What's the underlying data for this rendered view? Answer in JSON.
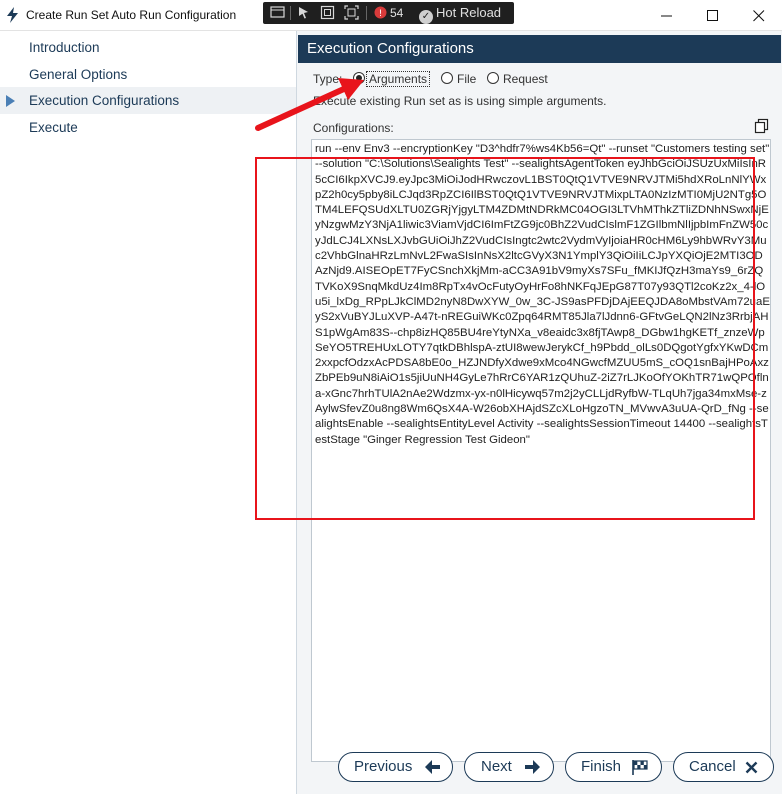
{
  "window": {
    "title": "Create Run Set Auto Run Configuration",
    "debug_toolbar": {
      "count": "54",
      "hot_reload_label": "Hot Reload"
    }
  },
  "nav": {
    "items": [
      {
        "label": "Introduction"
      },
      {
        "label": "General Options"
      },
      {
        "label": "Execution Configurations"
      },
      {
        "label": "Execute"
      }
    ],
    "active_item": "Execution Configurations"
  },
  "panel": {
    "title": "Execution Configurations",
    "type_label": "Type:",
    "type_options": [
      {
        "label": "Arguments",
        "selected": true
      },
      {
        "label": "File",
        "selected": false
      },
      {
        "label": "Request",
        "selected": false
      }
    ],
    "description": "Execute existing Run set as is using simple arguments.",
    "configurations_label": "Configurations:",
    "configuration_text": "run --env Env3 --encryptionKey \"D3^hdfr7%ws4Kb56=Qt\" --runset \"Customers testing set\" --solution \"C:\\Solutions\\Sealights Test\" --sealightsAgentToken eyJhbGciOiJSUzUxMiIsInR5cCI6IkpXVCJ9.eyJpc3MiOiJodHRwczovL1BST0QtQ1VTVE9NRVJTMi5hdXRoLnNlYWxpZ2h0cy5pby8iLCJqd3RpZCI6IlBST0QtQ1VTVE9NRVJTMixpLTA0NzIzMTI0MjU2NTg5OTM4LEFQSUdXLTU0ZGRjYjgyLTM4ZDMtNDRkMC04OGI3LTVhMThkZTliZDNhNSwxNjEyNzgwMzY3NjA1liwic3ViamVjdCI6ImFtZG9jc0BhZ2VudCIslmF1ZGIlbmNlIjpbImFnZW50cyJdLCJ4LXNsLXJvbGUiOiJhZ2VudCIsIngtc2wtc2VydmVyIjoiaHR0cHM6Ly9hbWRvY3Muc2VhbGlnaHRzLmNvL2FwaSIsInNsX2ltcGVyX3N1YmplY3QiOiIiLCJpYXQiOjE2MTI3ODAzNjd9.AISEOpET7FyCSnchXkjMm-aCC3A91bV9myXs7SFu_fMKIJfQzH3maYs9_6rZQTVKoX9SnqMkdUz4Im8RpTx4vOcFutyOyHrFo8hNKFqJEpG87T07y93QTl2coKz2x_4-lOu5i_lxDg_RPpLJkClMD2nyN8DwXYW_0w_3C-JS9asPFDjDAjEEQJDA8oMbstVAm72uaEyS2xVuBYJLuXVP-A47t-nREGuiWKc0Zpq64RMT85Jla7lJdnn6-GFtvGeLQN2lNz3RrbjAHS1pWgAm83S--chp8izHQ85BU4reYtyNXa_v8eaidc3x8fjTAwp8_DGbw1hgKETf_znzeWpSeYO5TREHUxLOTY7qtkDBhlspA-ztUI8wewJerykCf_h9Pbdd_olLs0DQgotYgfxYKwDCm2xxpcfOdzxAcPDSA8bE0o_HZJNDfyXdwe9xMco4NGwcfMZUU5mS_cOQ1snBajHPoAxzZbPEb9uN8iAiO1s5jiUuNH4GyLe7hRrC6YAR1zQUhuZ-2iZ7rLJKoOfYOKhTR71wQPOflna-xGnc7hrhTUlA2nAe2Wdzmx-yx-n0lHicywq57m2j2yCLLjdRyfbW-TLqUh7jga34mxMse-zAylwSfevZ0u8ng8Wm6QsX4A-W26obXHAjdSZcXLoHgzoTN_MVwvA3uUA-QrD_fNg --sealightsEnable --sealightsEntityLevel Activity --sealightsSessionTimeout 14400 --sealightsTestStage \"Ginger Regression Test Gideon\""
  },
  "buttons": {
    "previous": "Previous",
    "next": "Next",
    "finish": "Finish",
    "cancel": "Cancel"
  },
  "icons": {
    "app": "lightning-bolt-icon",
    "copy": "copy-icon",
    "previous": "arrow-left-icon",
    "next": "arrow-right-icon",
    "finish": "checkered-flag-icon",
    "cancel": "close-icon"
  },
  "colors": {
    "navy": "#1c3a57",
    "panel_bg": "#f3f5f7",
    "annotation_red": "#e8141b",
    "nav_arrow": "#4a7fb5"
  }
}
